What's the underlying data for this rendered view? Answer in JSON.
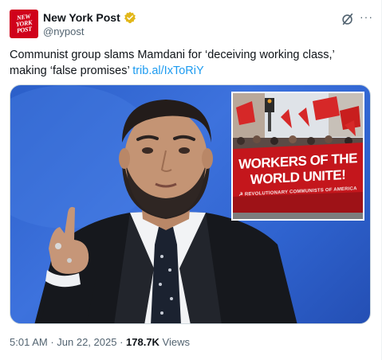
{
  "account": {
    "display_name": "New York Post",
    "handle": "@nypost",
    "avatar_text": [
      "NEW",
      "YORK",
      "POST"
    ]
  },
  "tweet": {
    "text": "Communist group slams Mamdani for ‘deceiving working class,’ making ‘false promises’ ",
    "link_text": "trib.al/IxToRiY"
  },
  "media": {
    "banner_line1": "WORKERS OF THE",
    "banner_line2": "WORLD UNITE!",
    "banner_line3": "☭ REVOLUTIONARY COMMUNISTS OF AMERICA"
  },
  "meta": {
    "time": "5:01 AM",
    "separator": " · ",
    "date": "Jun 22, 2025",
    "separator2": " · ",
    "views_count": "178.7K",
    "views_label": " Views"
  },
  "icons": {
    "verified": "verified-badge-icon",
    "grok": "grok-icon",
    "more": "more-icon"
  },
  "colors": {
    "brand_red": "#d0021b",
    "link_blue": "#1d9bf0",
    "verified_gold": "#e2b719",
    "muted": "#536471"
  }
}
